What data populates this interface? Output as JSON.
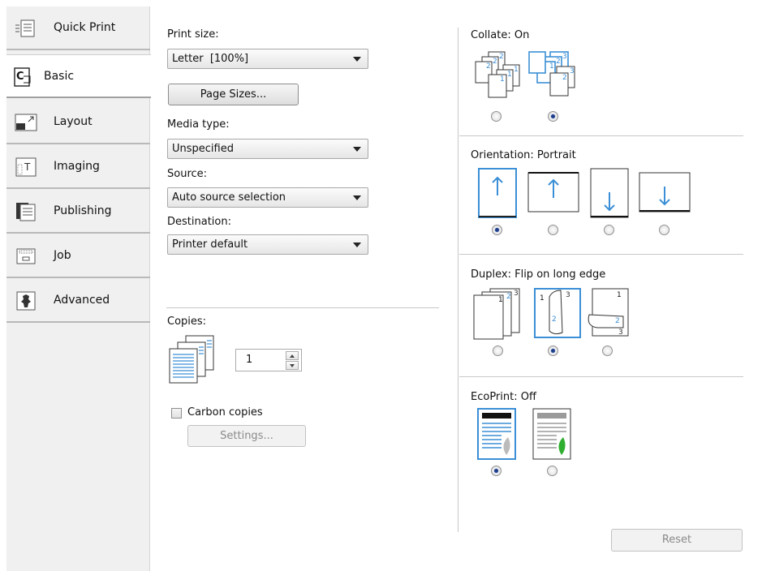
{
  "sidebar": {
    "tabs": [
      {
        "label": "Quick Print",
        "icon": "quick-print-icon"
      },
      {
        "label": "Basic",
        "icon": "basic-icon"
      },
      {
        "label": "Layout",
        "icon": "layout-icon"
      },
      {
        "label": "Imaging",
        "icon": "imaging-icon"
      },
      {
        "label": "Publishing",
        "icon": "publishing-icon"
      },
      {
        "label": "Job",
        "icon": "job-icon"
      },
      {
        "label": "Advanced",
        "icon": "advanced-icon"
      }
    ],
    "active_tab": "Basic"
  },
  "basic": {
    "print_size_label": "Print size:",
    "print_size_value": "Letter  [100%]",
    "page_sizes_button": "Page Sizes...",
    "media_type_label": "Media type:",
    "media_type_value": "Unspecified",
    "source_label": "Source:",
    "source_value": "Auto source selection",
    "destination_label": "Destination:",
    "destination_value": "Printer default",
    "copies_label": "Copies:",
    "copies_value": "1",
    "carbon_copies_label": "Carbon copies",
    "carbon_copies_checked": false,
    "settings_button": "Settings..."
  },
  "collate": {
    "label": "Collate:",
    "value": "On",
    "options": [
      "uncollated",
      "collated"
    ],
    "selected_index": 1
  },
  "orientation": {
    "label": "Orientation:",
    "value": "Portrait",
    "options": [
      "portrait",
      "landscape",
      "portrait-rotated",
      "landscape-rotated"
    ],
    "selected_index": 0
  },
  "duplex": {
    "label": "Duplex:",
    "value": "Flip on long edge",
    "options": [
      "off",
      "flip-long-edge",
      "flip-short-edge"
    ],
    "selected_index": 1
  },
  "ecoprint": {
    "label": "EcoPrint:",
    "value": "Off",
    "options": [
      "off",
      "on"
    ],
    "selected_index": 0
  },
  "reset_button": "Reset",
  "colors": {
    "accent_blue": "#3b8fd6",
    "eco_green": "#2fae2f",
    "sidebar_bg": "#f0f0f0"
  }
}
